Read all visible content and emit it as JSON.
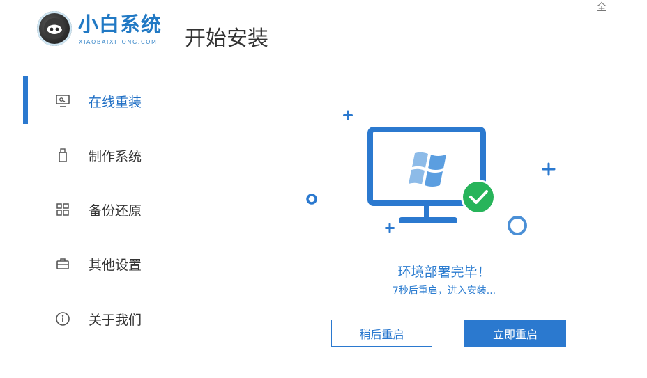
{
  "header": {
    "logo_name": "小白系统",
    "logo_sub": "XIAOBAIXITONG.COM",
    "page_title": "开始安装",
    "corner_char": "全"
  },
  "sidebar": {
    "items": [
      {
        "label": "在线重装",
        "icon": "monitor-icon",
        "active": true
      },
      {
        "label": "制作系统",
        "icon": "usb-drive-icon",
        "active": false
      },
      {
        "label": "备份还原",
        "icon": "grid-blocks-icon",
        "active": false
      },
      {
        "label": "其他设置",
        "icon": "briefcase-icon",
        "active": false
      },
      {
        "label": "关于我们",
        "icon": "info-icon",
        "active": false
      }
    ]
  },
  "main": {
    "status_title": "环境部署完毕！",
    "status_sub": "7秒后重启，进入安装...",
    "btn_later": "稍后重启",
    "btn_now": "立即重启"
  },
  "colors": {
    "accent": "#2b79cf",
    "success": "#27b45a",
    "text": "#333333"
  }
}
